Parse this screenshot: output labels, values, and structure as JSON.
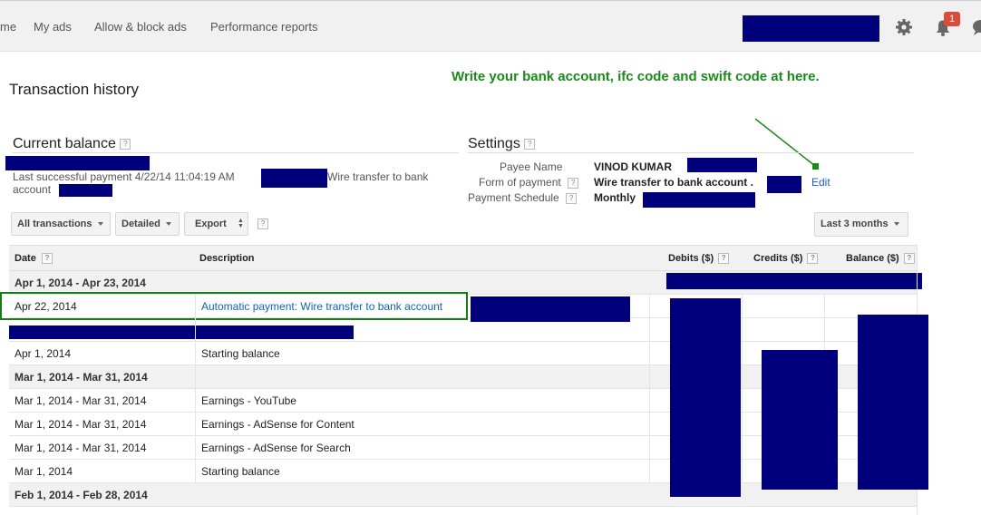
{
  "nav": {
    "home_partial": "me",
    "my_ads": "My ads",
    "allow_block": "Allow & block ads",
    "performance": "Performance reports",
    "notification_count": "1"
  },
  "page_title": "Transaction history",
  "annotation": "Write your bank account, ifc code and swift code at here.",
  "current_balance": {
    "title": "Current balance",
    "help": "?",
    "last_payment_line1": "Last successful payment 4/22/14 11:04:19 AM",
    "last_payment_method": "Wire transfer to bank",
    "last_payment_line2": "account"
  },
  "settings": {
    "title": "Settings",
    "help": "?",
    "payee_label": "Payee Name",
    "payee_value": "VINOD KUMAR",
    "form_label": "Form of payment",
    "form_value": "Wire transfer to bank account",
    "form_suffix": ".",
    "schedule_label": "Payment Schedule",
    "schedule_value": "Monthly",
    "edit_link": "Edit"
  },
  "toolbar": {
    "all_transactions": "All transactions",
    "detailed": "Detailed",
    "export": "Export",
    "help": "?",
    "range": "Last 3 months"
  },
  "table": {
    "headers": {
      "date": "Date",
      "description": "Description",
      "debits": "Debits ($)",
      "credits": "Credits ($)",
      "balance": "Balance ($)",
      "help": "?"
    },
    "groups": [
      {
        "label": "Apr 1, 2014 - Apr 23, 2014"
      },
      {
        "label": "Mar 1, 2014 - Mar 31, 2014"
      },
      {
        "label": "Feb 1, 2014 - Feb 28, 2014"
      }
    ],
    "rows": [
      {
        "date": "Apr 22, 2014",
        "description": "Automatic payment: Wire transfer to bank account"
      },
      {
        "date": "Apr 1, 2014",
        "description": "Starting balance"
      },
      {
        "date": "Mar 1, 2014 - Mar 31, 2014",
        "description": "Earnings - YouTube"
      },
      {
        "date": "Mar 1, 2014 - Mar 31, 2014",
        "description": "Earnings - AdSense for Content"
      },
      {
        "date": "Mar 1, 2014 - Mar 31, 2014",
        "description": "Earnings - AdSense for Search"
      },
      {
        "date": "Mar 1, 2014",
        "description": "Starting balance"
      }
    ]
  },
  "colors": {
    "redaction": "#00007d",
    "annotation_green": "#1a8a1a",
    "link_blue": "#1a5fb4"
  }
}
